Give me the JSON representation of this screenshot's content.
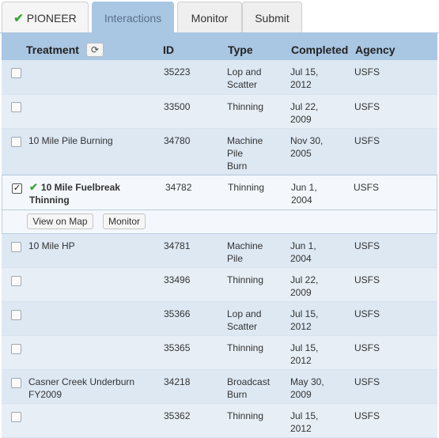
{
  "tabs": [
    {
      "label": "PIONEER",
      "icon": "check-icon"
    },
    {
      "label": "Interactions"
    },
    {
      "label": "Monitor"
    },
    {
      "label": "Submit"
    }
  ],
  "table": {
    "headers": {
      "treatment": "Treatment",
      "id": "ID",
      "type": "Type",
      "completed": "Completed",
      "agency": "Agency"
    },
    "refresh_icon": "refresh-icon",
    "rows": [
      {
        "treatment": "",
        "id": "35223",
        "type": [
          "Lop and",
          "Scatter"
        ],
        "completed": [
          "Jul 15,",
          "2012"
        ],
        "agency": "USFS",
        "checked": false
      },
      {
        "treatment": "",
        "id": "33500",
        "type": [
          "Thinning"
        ],
        "completed": [
          "Jul 22,",
          "2009"
        ],
        "agency": "USFS",
        "checked": false
      },
      {
        "treatment": "10 Mile Pile Burning",
        "id": "34780",
        "type": [
          "Machine",
          "Pile",
          "Burn"
        ],
        "completed": [
          "Nov 30,",
          "2005"
        ],
        "agency": "USFS",
        "checked": false
      },
      {
        "treatment": [
          "10 Mile Fuelbreak",
          "Thinning"
        ],
        "id": "34782",
        "type": [
          "Thinning"
        ],
        "completed": [
          "Jun 1,",
          "2004"
        ],
        "agency": "USFS",
        "checked": true
      },
      {
        "treatment": "10 Mile HP",
        "id": "34781",
        "type": [
          "Machine",
          "Pile"
        ],
        "completed": [
          "Jun 1,",
          "2004"
        ],
        "agency": "USFS",
        "checked": false
      },
      {
        "treatment": "",
        "id": "33496",
        "type": [
          "Thinning"
        ],
        "completed": [
          "Jul 22,",
          "2009"
        ],
        "agency": "USFS",
        "checked": false
      },
      {
        "treatment": "",
        "id": "35366",
        "type": [
          "Lop and",
          "Scatter"
        ],
        "completed": [
          "Jul 15,",
          "2012"
        ],
        "agency": "USFS",
        "checked": false
      },
      {
        "treatment": "",
        "id": "35365",
        "type": [
          "Thinning"
        ],
        "completed": [
          "Jul 15,",
          "2012"
        ],
        "agency": "USFS",
        "checked": false
      },
      {
        "treatment": [
          "Casner Creek Underburn",
          "FY2009"
        ],
        "id": "34218",
        "type": [
          "Broadcast",
          "Burn"
        ],
        "completed": [
          "May 30,",
          "2009"
        ],
        "agency": "USFS",
        "checked": false
      },
      {
        "treatment": "",
        "id": "35362",
        "type": [
          "Thinning"
        ],
        "completed": [
          "Jul 15,",
          "2012"
        ],
        "agency": "USFS",
        "checked": false
      }
    ],
    "selected_actions": {
      "view_on_map": "View on Map",
      "monitor": "Monitor"
    }
  },
  "colors": {
    "tab_active": "#a9c6e3",
    "header_bg": "#a9c6e3",
    "check_green": "#3aa63a",
    "row_alt": "#dde8f3"
  }
}
